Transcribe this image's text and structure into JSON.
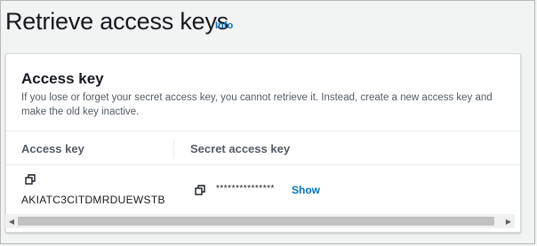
{
  "page": {
    "title": "Retrieve access keys",
    "info_link": "Info"
  },
  "panel": {
    "title": "Access key",
    "description": "If you lose or forget your secret access key, you cannot retrieve it. Instead, create a new access key and make the old key inactive."
  },
  "table": {
    "columns": [
      "Access key",
      "Secret access key"
    ],
    "row": {
      "access_key": "AKIATC3CITDMRDUEWSTB",
      "secret_masked": "***************",
      "show_label": "Show"
    }
  },
  "icons": {
    "copy_access_key": "copy-icon",
    "copy_secret": "copy-icon"
  },
  "colors": {
    "link": "#0073bb",
    "text": "#16191f",
    "muted": "#545b64",
    "background": "#f2f3f3"
  }
}
